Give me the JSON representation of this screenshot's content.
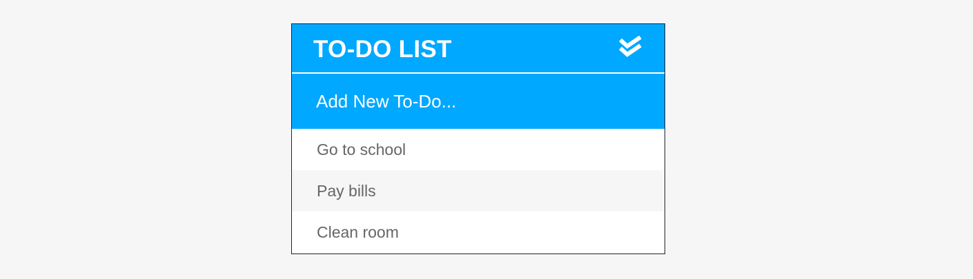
{
  "header": {
    "title": "TO-DO LIST",
    "icon": "double-check-icon"
  },
  "add_input": {
    "placeholder": "Add New To-Do...",
    "value": ""
  },
  "todos": [
    {
      "text": "Go to school"
    },
    {
      "text": "Pay bills"
    },
    {
      "text": "Clean room"
    }
  ],
  "colors": {
    "accent": "#00a8ff",
    "background": "#f6f6f6",
    "item_text": "#666666",
    "item_alt_background": "#f6f6f6"
  }
}
